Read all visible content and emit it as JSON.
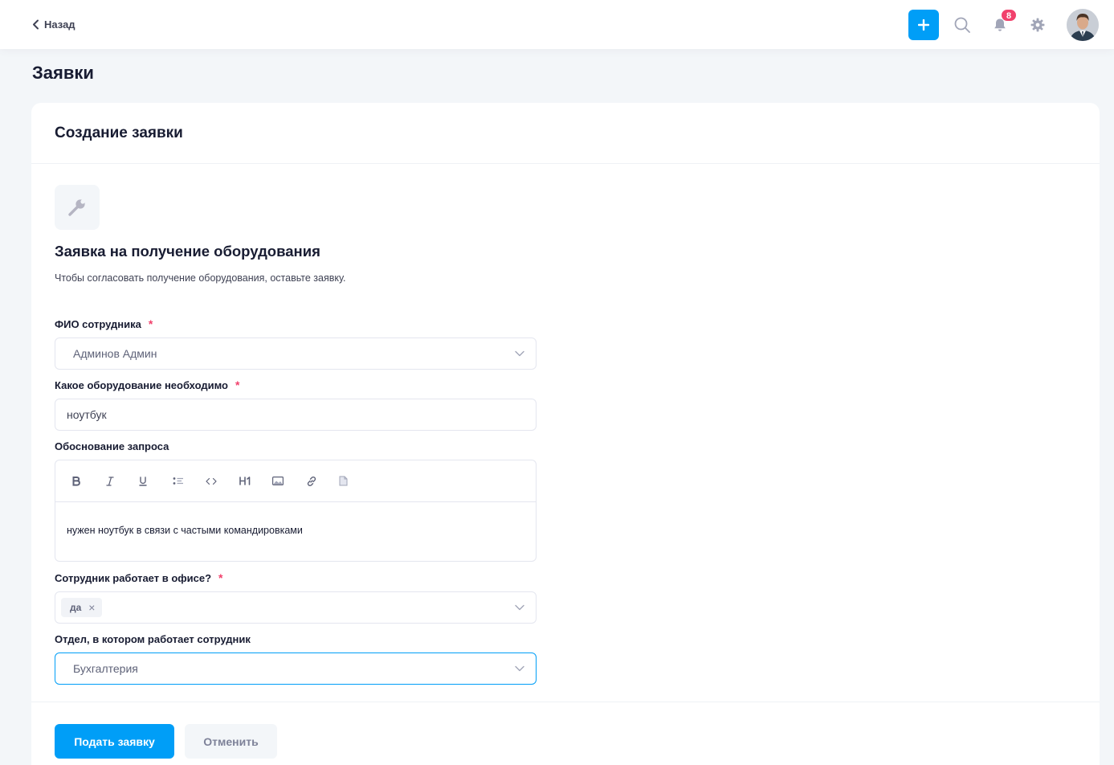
{
  "header": {
    "back_label": "Назад",
    "notifications_count": "8",
    "accent_color": "#009ef7",
    "badge_color": "#f1416c"
  },
  "page": {
    "title": "Заявки"
  },
  "card": {
    "title": "Создание заявки",
    "form_icon": "wrench-icon",
    "form_heading": "Заявка на получение оборудования",
    "form_description": "Чтобы согласовать получение оборудования, оставьте заявку."
  },
  "fields": {
    "employee": {
      "label": "ФИО сотрудника",
      "required_mark": "*",
      "value": "Админов Админ"
    },
    "equipment": {
      "label": "Какое оборудование необходимо",
      "required_mark": "*",
      "value": "ноутбук"
    },
    "justification": {
      "label": "Обоснование запроса",
      "value": "нужен ноутбук в связи с частыми командировками",
      "toolbar": [
        "bold-icon",
        "italic-icon",
        "underline-icon",
        "bullet-list-icon",
        "code-icon",
        "H1",
        "image-icon",
        "link-icon",
        "file-icon"
      ]
    },
    "in_office": {
      "label": "Сотрудник работает в офисе?",
      "required_mark": "*",
      "tag": "да",
      "remove_glyph": "×"
    },
    "department": {
      "label": "Отдел, в котором работает сотрудник",
      "value": "Бухгалтерия"
    }
  },
  "actions": {
    "submit_label": "Подать заявку",
    "cancel_label": "Отменить"
  }
}
